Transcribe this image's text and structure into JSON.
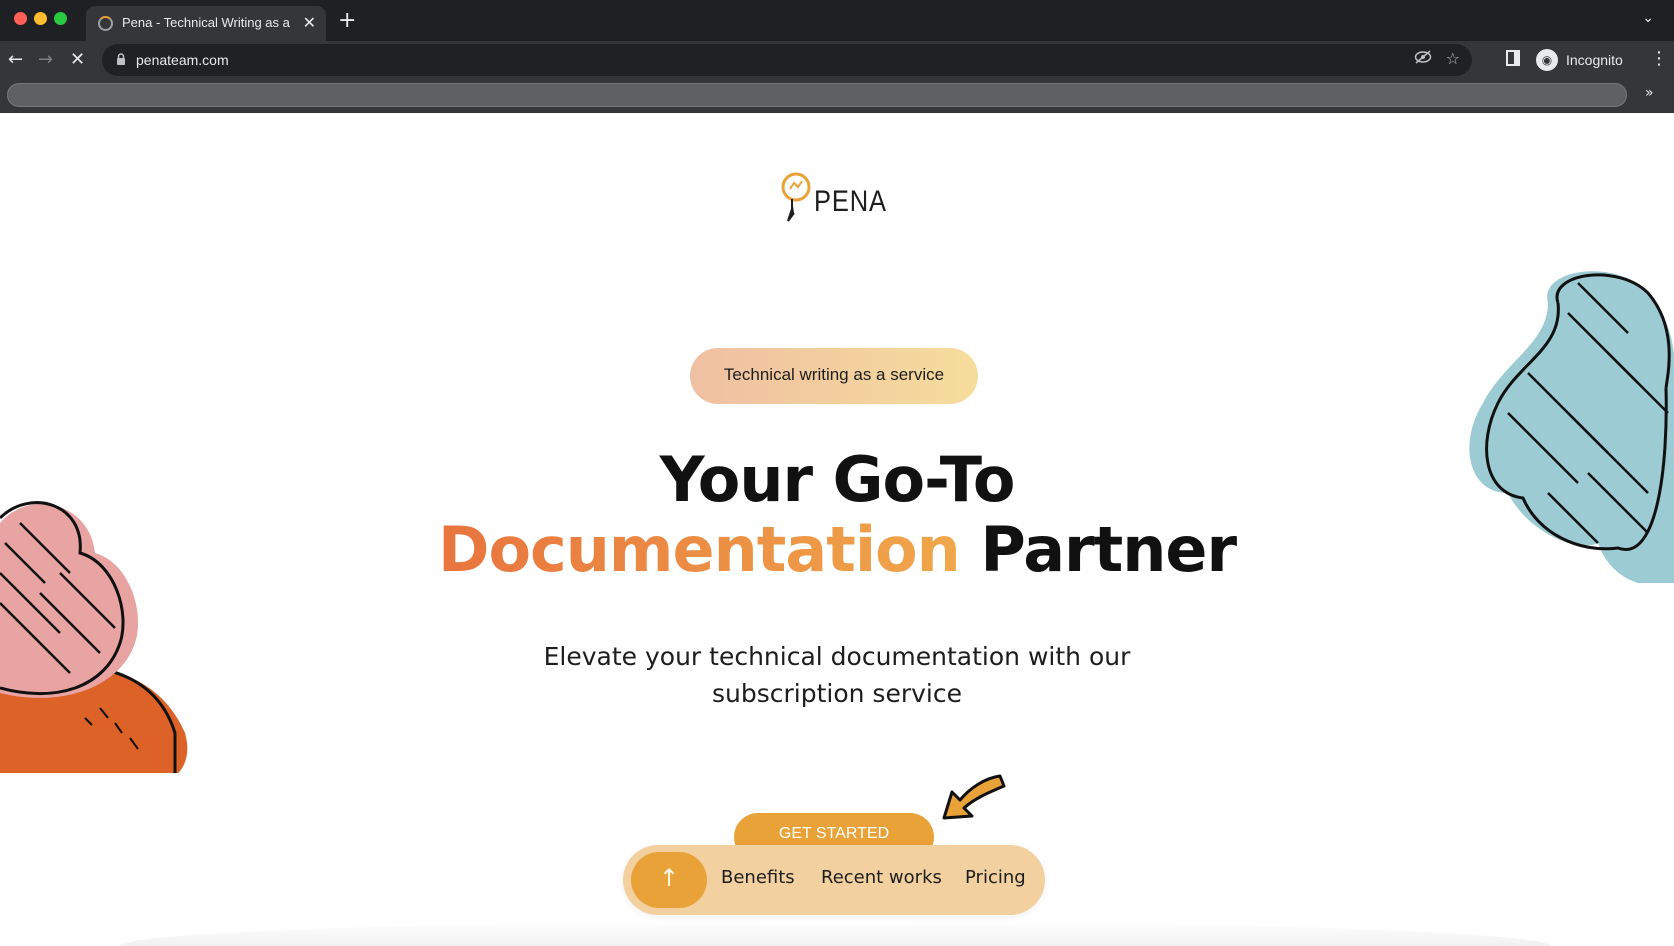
{
  "browser": {
    "tab_title": "Pena - Technical Writing as a Service",
    "tab_close": "✕",
    "new_tab": "+",
    "tab_list": "⌄",
    "url": "penateam.com",
    "profile_label": "Incognito",
    "overflow": "»"
  },
  "icons": {
    "back": "←",
    "forward": "→",
    "stop": "✕",
    "lock": "🔒",
    "eye_off": "◌",
    "star": "☆",
    "kebab": "⋮",
    "up_arrow": "↑"
  },
  "page": {
    "logo_text": "PENA",
    "badge": "Technical writing as a service",
    "headline_line1": "Your Go-To",
    "headline_accent": "Documentation",
    "headline_line2_rest": "Partner",
    "subhead_line1": "Elevate your technical documentation with our",
    "subhead_line2": "subscription service",
    "cta_label": "GET STARTED"
  },
  "dock": {
    "items": [
      {
        "label": "Benefits"
      },
      {
        "label": "Recent works"
      },
      {
        "label": "Pricing"
      }
    ]
  },
  "colors": {
    "accent": "#e9a238",
    "headline_gradient_start": "#e8743e",
    "headline_gradient_end": "#f0a74a",
    "deco_blue": "#9ccbd4",
    "deco_pink": "#e8a3a3",
    "deco_orange": "#dd6228"
  }
}
